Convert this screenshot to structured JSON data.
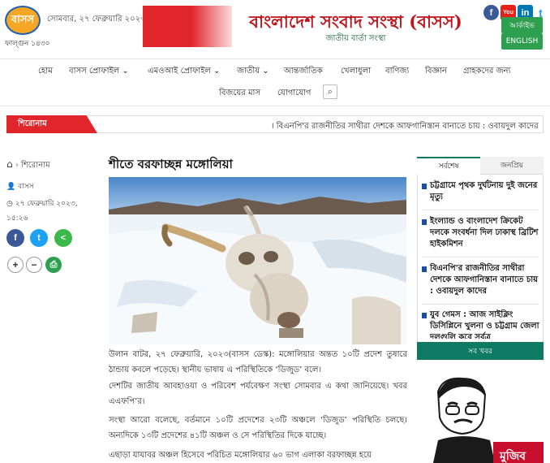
{
  "header": {
    "logo_text": "বাসস",
    "logo_sub": "ফাল্গুন ১৪৩০",
    "date_line": "সোমবার, ২৭ ফেব্রুয়ারি ২০২৩, ১২",
    "banner_title": "বাংলাদেশ সংবাদ সংস্থা (বাসস)",
    "banner_subtitle": "জাতীয় বার্তা সংস্থা",
    "social": {
      "facebook": "f",
      "youtube": "You",
      "linkedin": "in",
      "twitter": "t"
    },
    "archive_label": "আর্কাইভ",
    "english_label": "ENGLISH"
  },
  "nav": {
    "items": [
      "হোম",
      "বাসস প্রোফাইল",
      "এমওআই প্রোফাইল",
      "জাতীয়",
      "আন্তর্জাতিক",
      "খেলাধুলা",
      "বাণিজ্য",
      "বিজ্ঞান",
      "গ্রাহকদের জন্য"
    ],
    "items_row2": [
      "বিজয়ের মাস",
      "যোগাযোগ"
    ],
    "search_icon": "⌕"
  },
  "ticker": {
    "label": "শিরোনাম",
    "text": "। বিএনপি'র রাজনীতির সাথীরা দেশকে আফগানিস্তান বানাতে চায় : ওবায়দুল কাদের"
  },
  "meta": {
    "breadcrumb_home": "⌂",
    "breadcrumb_section": "শিরোনাম",
    "author": "বাসস",
    "date": "২৭ ফেব্রুয়ারি ২০২৩,",
    "time": "১৫:২৬",
    "share": {
      "facebook": "f",
      "twitter": "t",
      "share": "<"
    },
    "font_plus": "+",
    "font_minus": "−",
    "print": "⎙"
  },
  "article": {
    "title": "শীতে বরফাচ্ছন্ন মঙ্গোলিয়া",
    "paragraphs": [
      "উলান বাটর, ২৭ ফেব্রুয়ারি, ২০২৩(বাসস ডেস্ক): মঙ্গোলিয়ার অন্তত ১০টি প্রদেশ তুষারে ঠান্ডায় কবলে পড়েছে। স্থানীয় ভাষায় এ পরিস্থিতিকে ‘ডিজুড’ বলে।",
      "দেশটির জাতীয় আবহাওয়া ও পরিবেশ পর্যবেক্ষণ সংস্থা সোমবার এ কথা জানিয়েছে। খবর এএফপি’র।",
      "সংস্থা আরো বলেছে, বর্তমানে ১০টি প্রদেশের ২৩টি অঞ্চলে ‘ডিজুড’ পরিস্থিতি চলছে। অন্যদিকে ১৩টি প্রদেশের ৪১টি অঞ্চল ও সে পরিস্থিতির দিকে যাচ্ছে।",
      "এছাড়া যাযাবর অঞ্চল হিসেবে পরিচিত মঙ্গোলিয়ার ৬০ ভাগ এলাকা বরফাচ্ছন্ন হয়ে"
    ]
  },
  "sidebar": {
    "tab_latest": "সর্বশেষ",
    "tab_popular": "জনপ্রিয়",
    "items": [
      "চট্টগ্রামে পৃথক দুর্ঘটনায় দুই জনের মৃত্যু",
      "ইংল্যান্ড ও বাংলাদেশ ক্রিকেট দলকে সংবর্ধনা দিল ঢাকাস্থ ব্রিটিশ হাইকমিশন",
      "বিএনপি'র রাজনীতির সাথীরা দেশকে আফগানিস্তান বানাতে চায় : ওবায়দুল কাদের",
      "যুব গেমস : আজ সাইক্লিং ডিসিপ্লিনে খুলনা ও চট্টগ্রাম জেলা দলগুলি করে সর্বত্র"
    ],
    "all_news": "সব খবর",
    "promo_text": "মুজিব"
  }
}
